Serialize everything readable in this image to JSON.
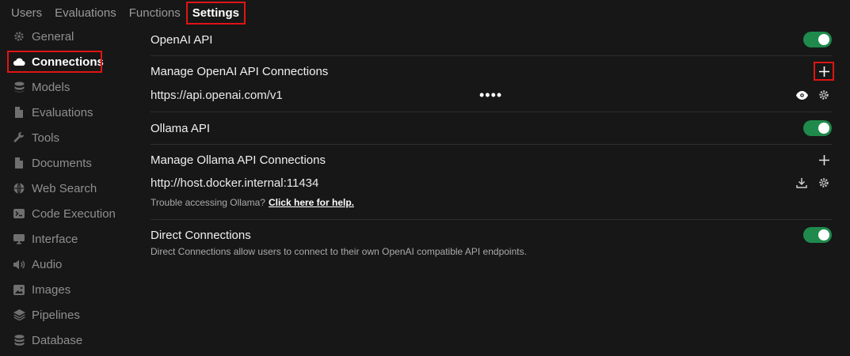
{
  "top_tabs": [
    "Users",
    "Evaluations",
    "Functions",
    "Settings"
  ],
  "sidebar": {
    "items": [
      {
        "label": "General",
        "icon": "gear-icon"
      },
      {
        "label": "Connections",
        "icon": "cloud-icon"
      },
      {
        "label": "Models",
        "icon": "stack-icon"
      },
      {
        "label": "Evaluations",
        "icon": "document-icon"
      },
      {
        "label": "Tools",
        "icon": "wrench-icon"
      },
      {
        "label": "Documents",
        "icon": "document-icon"
      },
      {
        "label": "Web Search",
        "icon": "globe-icon"
      },
      {
        "label": "Code Execution",
        "icon": "terminal-icon"
      },
      {
        "label": "Interface",
        "icon": "monitor-icon"
      },
      {
        "label": "Audio",
        "icon": "speaker-icon"
      },
      {
        "label": "Images",
        "icon": "image-icon"
      },
      {
        "label": "Pipelines",
        "icon": "layers-icon"
      },
      {
        "label": "Database",
        "icon": "database-icon"
      }
    ]
  },
  "openai": {
    "title": "OpenAI API",
    "manage_title": "Manage OpenAI API Connections",
    "url": "https://api.openai.com/v1",
    "masked_key": "••••"
  },
  "ollama": {
    "title": "Ollama API",
    "manage_title": "Manage Ollama API Connections",
    "url": "http://host.docker.internal:11434",
    "help_prefix": "Trouble accessing Ollama?",
    "help_link": "Click here for help."
  },
  "direct": {
    "title": "Direct Connections",
    "description": "Direct Connections allow users to connect to their own OpenAI compatible API endpoints."
  },
  "colors": {
    "background": "#171717",
    "toggle_on": "#1f8a4c",
    "highlight": "#e01414"
  }
}
